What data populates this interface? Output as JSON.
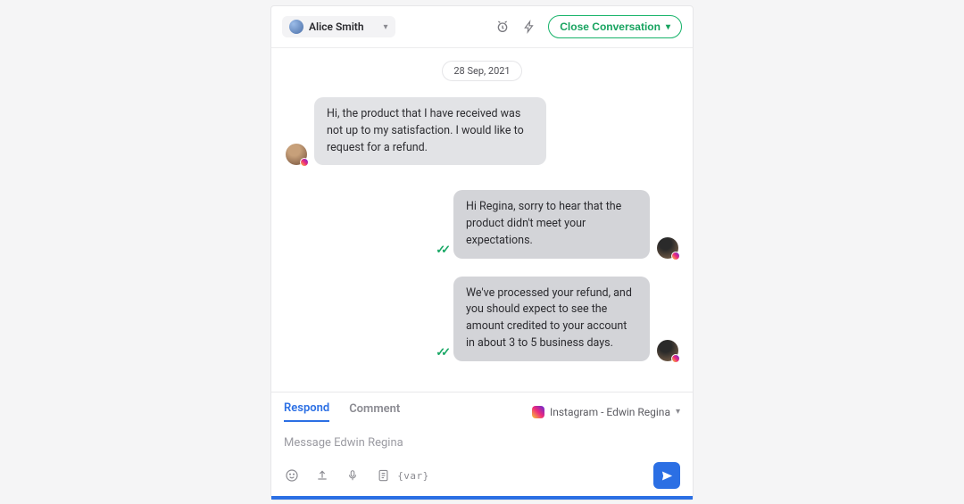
{
  "header": {
    "assignee_name": "Alice Smith",
    "close_label": "Close Conversation"
  },
  "date_sep": "28 Sep, 2021",
  "messages": {
    "m1": "Hi, the product that I have received was not up to my satisfaction. I would like to request for a refund.",
    "m2": "Hi Regina, sorry to hear that the product didn't meet your expectations.",
    "m3": "We've processed your refund, and you should expect to see the amount credited to your account in about 3 to 5 business days."
  },
  "composer": {
    "tab_respond": "Respond",
    "tab_comment": "Comment",
    "channel_label": "Instagram - Edwin Regina",
    "placeholder": "Message Edwin Regina",
    "var_label": "{var}"
  }
}
